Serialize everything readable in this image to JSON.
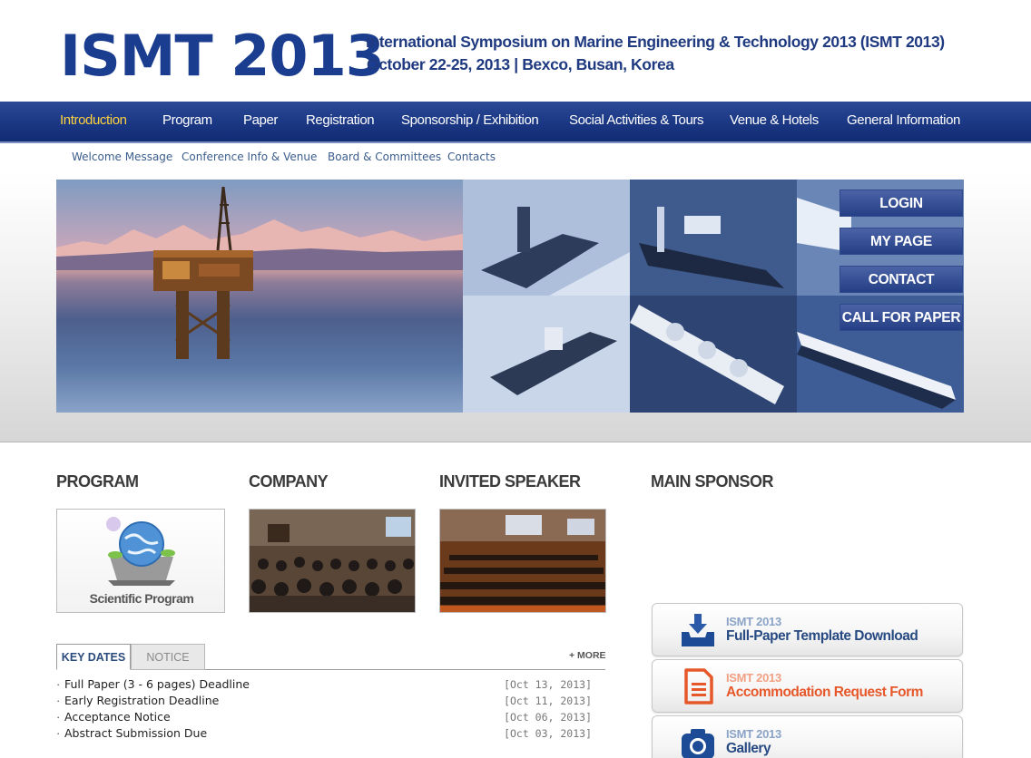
{
  "header": {
    "logo": "ISMT 2013",
    "title": "International Symposium on Marine Engineering & Technology 2013 (ISMT 2013)",
    "subtitle": "October 22-25, 2013 | Bexco, Busan, Korea"
  },
  "nav": {
    "items": [
      "Introduction",
      "Program",
      "Paper",
      "Registration",
      "Sponsorship / Exhibition",
      "Social Activities & Tours",
      "Venue & Hotels",
      "General Information"
    ],
    "active": "Introduction"
  },
  "subnav": {
    "items": [
      "Welcome Message",
      "Conference Info & Venue",
      "Board & Committees",
      "Contacts"
    ]
  },
  "quick_buttons": [
    "LOGIN",
    "MY PAGE",
    "CONTACT",
    "CALL FOR PAPER"
  ],
  "sections": {
    "program": "PROGRAM",
    "company": "COMPANY",
    "invited_speaker": "INVITED SPEAKER",
    "main_sponsor": "MAIN SPONSOR"
  },
  "program_card_caption": "Scientific Program",
  "tabs": {
    "key_dates": "KEY DATES",
    "notice": "NOTICE",
    "more": "+ MORE"
  },
  "key_dates": [
    {
      "title": "Full Paper (3 - 6 pages) Deadline",
      "date": "[Oct 13, 2013]"
    },
    {
      "title": "Early Registration Deadline",
      "date": "[Oct 11, 2013]"
    },
    {
      "title": "Acceptance Notice",
      "date": "[Oct 06, 2013]"
    },
    {
      "title": "Abstract Submission Due",
      "date": "[Oct 03, 2013]"
    }
  ],
  "quick_links": [
    {
      "small": "ISMT 2013",
      "big": "Full-Paper Template Download",
      "icon": "download-icon"
    },
    {
      "small": "ISMT 2013",
      "big": "Accommodation Request Form",
      "icon": "document-icon"
    },
    {
      "small": "ISMT 2013",
      "big": "Gallery",
      "icon": "camera-icon"
    }
  ],
  "colors": {
    "brand_blue": "#1b3d8f",
    "nav_active": "#ffd23f",
    "accent_orange": "#e6582a"
  }
}
